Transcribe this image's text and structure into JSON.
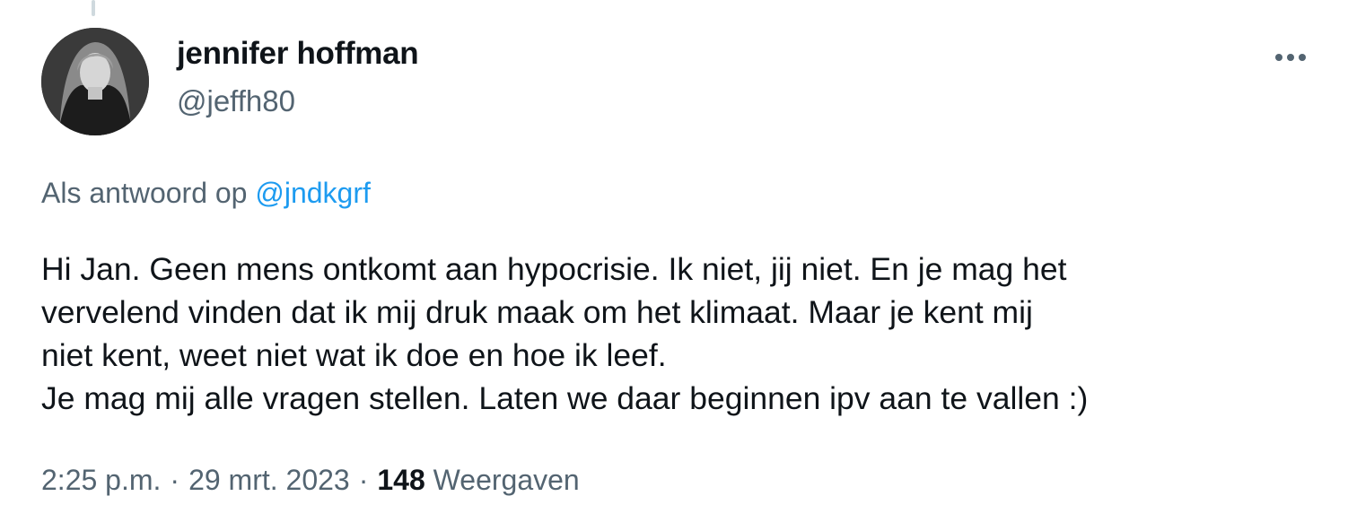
{
  "tweet": {
    "author": {
      "display_name": "jennifer hoffman",
      "handle": "@jeffh80"
    },
    "more_icon": "more-dots-icon",
    "reply_context": {
      "prefix": "Als antwoord op",
      "mention": "@jndkgrf"
    },
    "text_lines": [
      "Hi Jan. Geen mens ontkomt aan hypocrisie. Ik niet, jij niet. En je mag het",
      "vervelend vinden dat ik mij druk maak om het klimaat. Maar je kent mij",
      "niet kent, weet niet wat ik doe en hoe ik leef.",
      "Je mag mij alle vragen stellen. Laten we daar beginnen ipv aan te vallen :)"
    ],
    "time": "2:25 p.m.",
    "date": "29 mrt. 2023",
    "separator": "·",
    "views_count": "148",
    "views_label": "Weergaven"
  },
  "colors": {
    "text_primary": "#0f1419",
    "text_secondary": "#536471",
    "link": "#1d9bf0",
    "thread_line": "#cfd9de"
  }
}
